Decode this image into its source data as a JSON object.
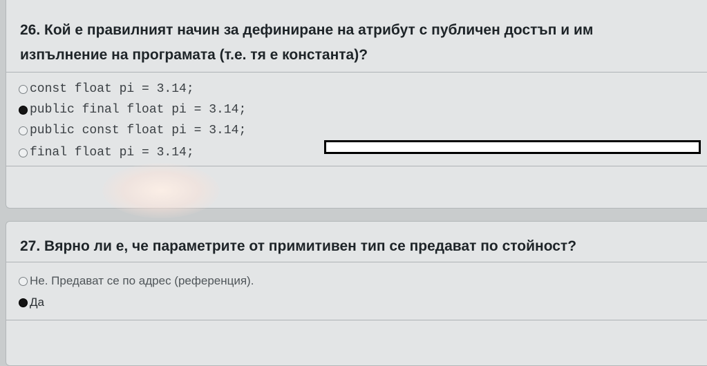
{
  "q26": {
    "title_line1": "26. Кой е правилният начин за дефиниране на атрибут с публичен достъп и им",
    "title_line2": "изпълнение на програмата (т.е. тя е константа)?",
    "options": [
      {
        "label": "const float pi = 3.14;",
        "checked": false
      },
      {
        "label": "public final float pi = 3.14;",
        "checked": true
      },
      {
        "label": "public const float pi = 3.14;",
        "checked": false
      },
      {
        "label": "final float pi = 3.14;",
        "checked": false
      }
    ]
  },
  "q27": {
    "title": "27. Вярно ли е, че параметрите от примитивен тип се предават по стойност?",
    "options": [
      {
        "label": "Не. Предават се по адрес (референция).",
        "checked": false
      },
      {
        "label": "Да",
        "checked": true
      }
    ]
  },
  "colors": {
    "background": "#c9cccd",
    "panel": "#e3e5e6",
    "title_text": "#1e2428",
    "option_text": "#3a3f43",
    "selected_radio": "#141414"
  }
}
